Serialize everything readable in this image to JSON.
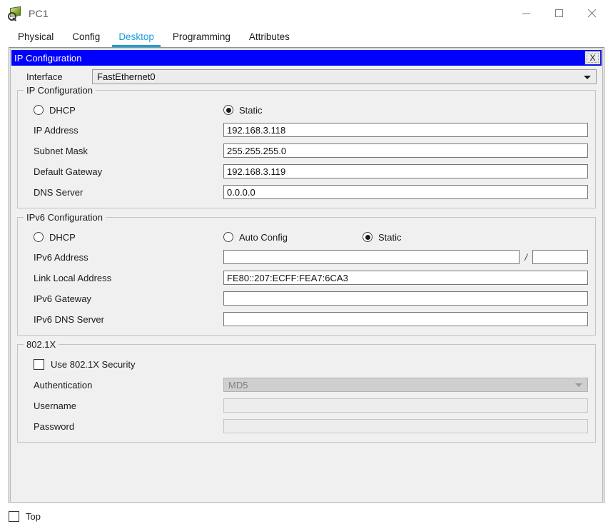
{
  "window": {
    "title": "PC1",
    "icon": "pc-magnifier-icon",
    "minimize_label": "—",
    "maximize_label": "□",
    "close_label": "✕"
  },
  "tabs": [
    {
      "label": "Physical",
      "active": false
    },
    {
      "label": "Config",
      "active": false
    },
    {
      "label": "Desktop",
      "active": true
    },
    {
      "label": "Programming",
      "active": false
    },
    {
      "label": "Attributes",
      "active": false
    }
  ],
  "app": {
    "title": "IP Configuration",
    "close_label": "X",
    "title_bg": "#0000ff",
    "accent": "#1a9ed8"
  },
  "interface": {
    "label": "Interface",
    "value": "FastEthernet0"
  },
  "ipv4": {
    "legend": "IP Configuration",
    "dhcp_label": "DHCP",
    "dhcp_selected": false,
    "static_label": "Static",
    "static_selected": true,
    "fields": [
      {
        "label": "IP Address",
        "value": "192.168.3.118"
      },
      {
        "label": "Subnet Mask",
        "value": "255.255.255.0"
      },
      {
        "label": "Default Gateway",
        "value": "192.168.3.119"
      },
      {
        "label": "DNS Server",
        "value": "0.0.0.0"
      }
    ]
  },
  "ipv6": {
    "legend": "IPv6 Configuration",
    "dhcp_label": "DHCP",
    "dhcp_selected": false,
    "auto_config_label": "Auto Config",
    "auto_config_selected": false,
    "static_label": "Static",
    "static_selected": true,
    "address_label": "IPv6 Address",
    "address_value": "",
    "prefix_separator": "/",
    "prefix_value": "",
    "link_local_label": "Link Local Address",
    "link_local_value": "FE80::207:ECFF:FEA7:6CA3",
    "gateway_label": "IPv6 Gateway",
    "gateway_value": "",
    "dns_label": "IPv6 DNS Server",
    "dns_value": ""
  },
  "dot1x": {
    "legend": "802.1X",
    "use_label": "Use 802.1X Security",
    "use_checked": false,
    "auth_label": "Authentication",
    "auth_value": "MD5",
    "username_label": "Username",
    "username_value": "",
    "password_label": "Password",
    "password_value": ""
  },
  "bottom": {
    "top_label": "Top",
    "top_checked": false
  }
}
